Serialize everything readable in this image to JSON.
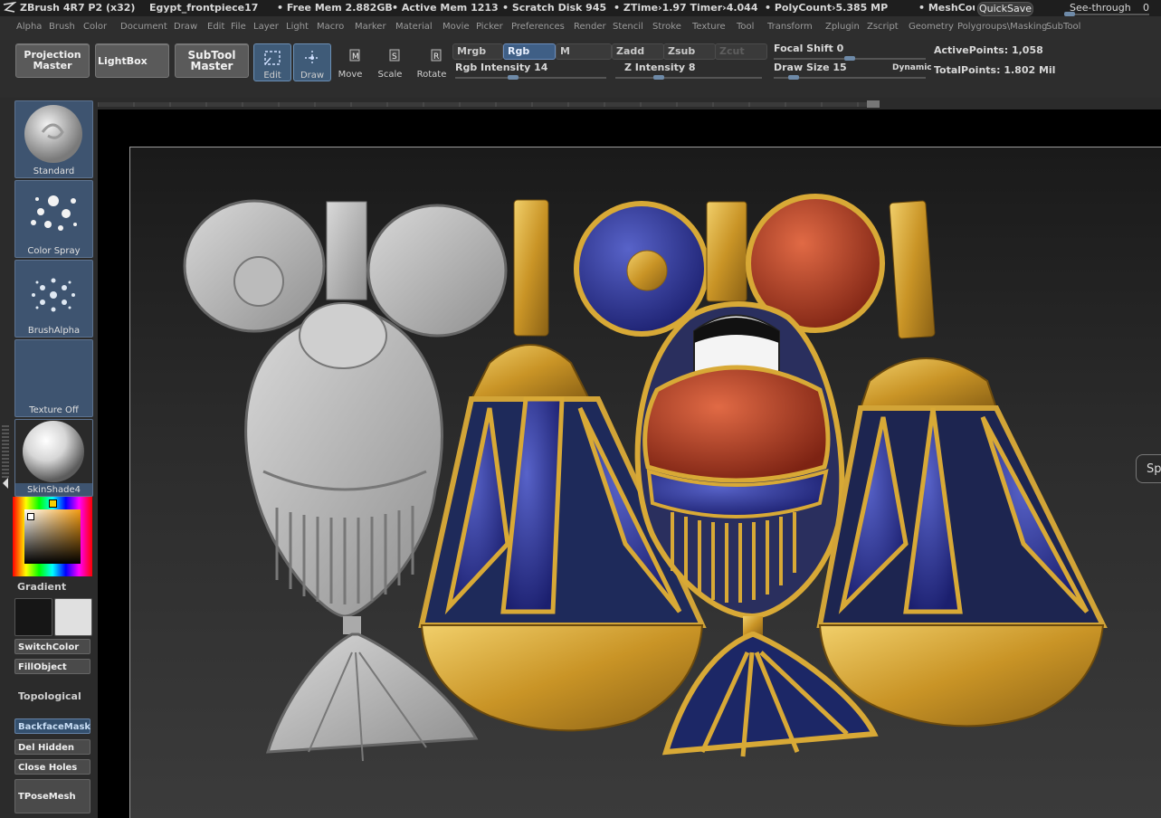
{
  "titlebar": {
    "app": "ZBrush 4R7 P2 (x32)",
    "document": "Egypt_frontpiece17",
    "free_mem": "• Free Mem 2.882GB",
    "active_mem": "• Active Mem 1213",
    "scratch_disk": "• Scratch Disk 945",
    "ztime": "• ZTime›1.97 Timer›4.044",
    "polycount": "• PolyCount›5.385 MP",
    "meshcount": "• MeshCount›",
    "quicksave": "QuickSave",
    "see_through": "See-through",
    "see_through_value": "0"
  },
  "menu": [
    "Alpha",
    "Brush",
    "Color",
    "Document",
    "Draw",
    "Edit",
    "File",
    "Layer",
    "Light",
    "Macro",
    "Marker",
    "Material",
    "Movie",
    "Picker",
    "Preferences",
    "Render",
    "Stencil",
    "Stroke",
    "Texture",
    "Tool",
    "Transform",
    "Zplugin",
    "Zscript",
    "Geometry",
    "Polygroups\\Masking",
    "SubTool"
  ],
  "toolbar": {
    "projection_master": "Projection\nMaster",
    "lightbox": "LightBox",
    "subtool_master": "SubTool\nMaster",
    "edit": "Edit",
    "draw": "Draw",
    "move": "Move",
    "scale": "Scale",
    "rotate": "Rotate",
    "mrgb": "Mrgb",
    "rgb": "Rgb",
    "m": "M",
    "rgb_intensity_label": "Rgb Intensity",
    "rgb_intensity": "14",
    "zadd": "Zadd",
    "zsub": "Zsub",
    "zcut": "Zcut",
    "z_intensity_label": "Z Intensity",
    "z_intensity": "8",
    "focal_shift_label": "Focal Shift",
    "focal_shift": "0",
    "draw_size_label": "Draw Size",
    "draw_size": "15",
    "dynamic": "Dynamic",
    "active_points_label": "ActivePoints:",
    "active_points": "1,058",
    "total_points_label": "TotalPoints:",
    "total_points": "1.802 Mil"
  },
  "tray": {
    "standard": "Standard",
    "color_spray": "Color Spray",
    "brush_alpha": "BrushAlpha",
    "texture_off": "Texture Off",
    "material": "SkinShade4",
    "gradient": "Gradient",
    "switch_color": "SwitchColor",
    "fill_object": "FillObject",
    "topological": "Topological",
    "backface_mask": "BackfaceMask",
    "del_hidden": "Del Hidden",
    "close_holes": "Close Holes",
    "tpose_mesh": "TPoseMesh"
  },
  "canvas": {
    "side_tab": "Sp"
  },
  "colors": {
    "accent_blue": "#3f5f86",
    "gold": "#d8a936",
    "lapis": "#2e3592",
    "carnelian": "#b8452b"
  }
}
